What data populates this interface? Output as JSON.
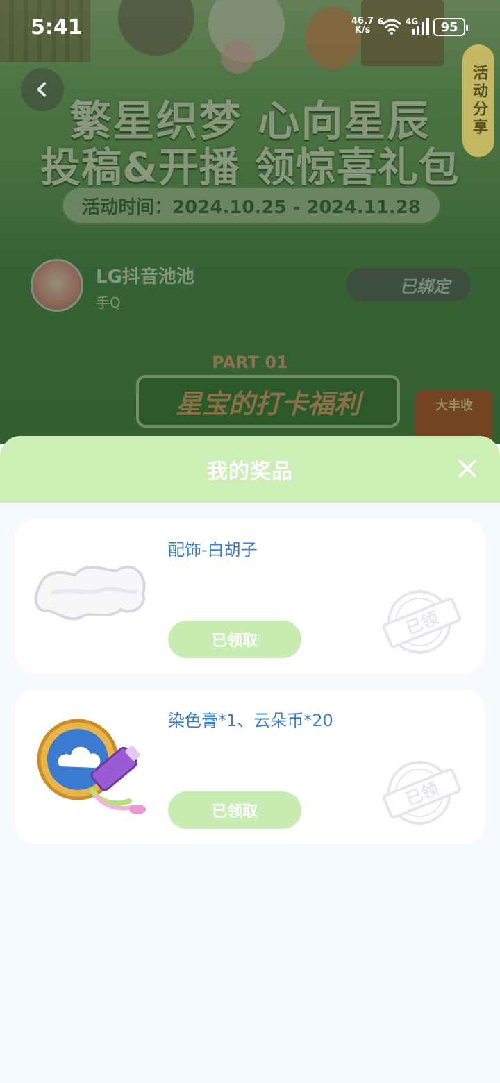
{
  "status_bar": {
    "time": "5:41",
    "net_speed_value": "46.7",
    "net_speed_unit": "K/s",
    "sim_slot": "6",
    "network_type": "4G",
    "battery": "95",
    "icons": [
      "wifi-icon",
      "signal-icon",
      "battery-icon"
    ]
  },
  "background_page": {
    "title_line1": "繁星织梦 心向星辰",
    "title_line2": "投稿&开播 领惊喜礼包",
    "event_time": "活动时间：2024.10.25 - 2024.11.28",
    "share_tab": "活动分享",
    "user": {
      "name": "LG抖音池池",
      "platform": "手Q",
      "bound_label": "已绑定"
    },
    "part_label": "PART 01",
    "part_title": "星宝的打卡福利",
    "badge_text": "大丰收"
  },
  "sheet": {
    "title": "我的奖品",
    "prizes": [
      {
        "name": "配饰-白胡子",
        "button_label": "已领取",
        "stamp_text": "已领",
        "icon": "white-beard-icon"
      },
      {
        "name": "染色膏*1、云朵币*20",
        "button_label": "已领取",
        "stamp_text": "已领",
        "icon": "dye-and-coin-icon"
      }
    ]
  },
  "colors": {
    "sheet_header": "#ccefb6",
    "prize_name": "#3c7fc4",
    "claim_button": "#c8edb3",
    "sheet_background": "#f6f9fd"
  }
}
